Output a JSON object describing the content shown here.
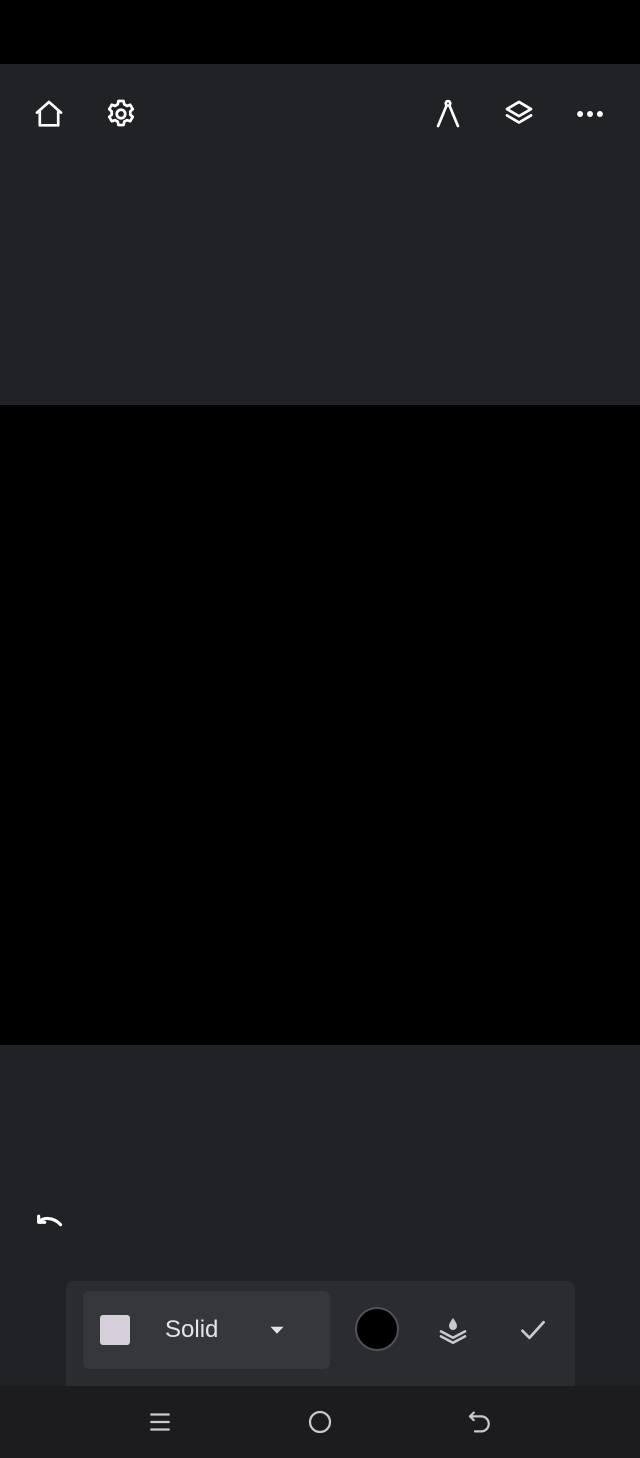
{
  "top_toolbar": {
    "icons": {
      "home": "home-icon",
      "settings": "gear-icon",
      "guides": "compass-icon",
      "layers": "layers-icon",
      "more": "more-horizontal-icon"
    }
  },
  "canvas": {
    "background": "#000000"
  },
  "history": {
    "undo_icon": "undo-icon"
  },
  "shape_toolbar": {
    "fill_style": {
      "label": "Solid",
      "swatch_color": "#d5cfdc",
      "dropdown_icon": "caret-down-icon"
    },
    "color": {
      "value": "#000000"
    },
    "layer_fill_icon": "layer-fill-icon",
    "confirm_icon": "check-icon"
  },
  "system_nav": {
    "recents_icon": "recents-icon",
    "home_icon": "home-circle-icon",
    "back_icon": "back-icon"
  },
  "colors": {
    "panel": "#212225",
    "toolbar": "#2b2c30",
    "icon": "#ffffff",
    "icon_muted": "#c8c9cd"
  }
}
